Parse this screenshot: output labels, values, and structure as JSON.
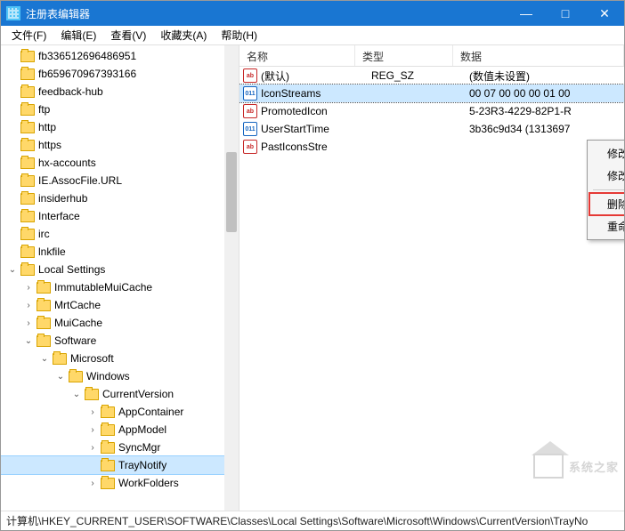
{
  "window": {
    "title": "注册表编辑器"
  },
  "menu": {
    "file": "文件(F)",
    "edit": "编辑(E)",
    "view": "查看(V)",
    "favorites": "收藏夹(A)",
    "help": "帮助(H)"
  },
  "tree": [
    {
      "label": "fb336512696486951",
      "depth": 0,
      "exp": ""
    },
    {
      "label": "fb659670967393166",
      "depth": 0,
      "exp": ""
    },
    {
      "label": "feedback-hub",
      "depth": 0,
      "exp": ""
    },
    {
      "label": "ftp",
      "depth": 0,
      "exp": ""
    },
    {
      "label": "http",
      "depth": 0,
      "exp": ""
    },
    {
      "label": "https",
      "depth": 0,
      "exp": ""
    },
    {
      "label": "hx-accounts",
      "depth": 0,
      "exp": ""
    },
    {
      "label": "IE.AssocFile.URL",
      "depth": 0,
      "exp": ""
    },
    {
      "label": "insiderhub",
      "depth": 0,
      "exp": ""
    },
    {
      "label": "Interface",
      "depth": 0,
      "exp": ""
    },
    {
      "label": "irc",
      "depth": 0,
      "exp": ""
    },
    {
      "label": "lnkfile",
      "depth": 0,
      "exp": ""
    },
    {
      "label": "Local Settings",
      "depth": 0,
      "exp": "open"
    },
    {
      "label": "ImmutableMuiCache",
      "depth": 1,
      "exp": "closed"
    },
    {
      "label": "MrtCache",
      "depth": 1,
      "exp": "closed"
    },
    {
      "label": "MuiCache",
      "depth": 1,
      "exp": "closed"
    },
    {
      "label": "Software",
      "depth": 1,
      "exp": "open"
    },
    {
      "label": "Microsoft",
      "depth": 2,
      "exp": "open"
    },
    {
      "label": "Windows",
      "depth": 3,
      "exp": "open"
    },
    {
      "label": "CurrentVersion",
      "depth": 4,
      "exp": "open"
    },
    {
      "label": "AppContainer",
      "depth": 5,
      "exp": "closed"
    },
    {
      "label": "AppModel",
      "depth": 5,
      "exp": "closed"
    },
    {
      "label": "SyncMgr",
      "depth": 5,
      "exp": "closed"
    },
    {
      "label": "TrayNotify",
      "depth": 5,
      "exp": "",
      "selected": true
    },
    {
      "label": "WorkFolders",
      "depth": 5,
      "exp": "closed"
    }
  ],
  "list": {
    "columns": {
      "name": "名称",
      "type": "类型",
      "data": "数据"
    },
    "rows": [
      {
        "icon": "str",
        "name": "(默认)",
        "type": "REG_SZ",
        "data": "(数值未设置)"
      },
      {
        "icon": "bin",
        "name": "IconStreams",
        "type": "",
        "data": "00 07 00 00 00 01 00",
        "selected": true
      },
      {
        "icon": "str",
        "name": "PromotedIcon",
        "type": "",
        "data": "5-23R3-4229-82P1-R"
      },
      {
        "icon": "bin",
        "name": "UserStartTime",
        "type": "",
        "data": "3b36c9d34 (1313697"
      },
      {
        "icon": "str",
        "name": "PastIconsStre",
        "type": "",
        "data": ""
      }
    ]
  },
  "context": {
    "modify": "修改(M)...",
    "modify_binary": "修改二进制数据(B)...",
    "delete": "删除(D)",
    "rename": "重命名(R)"
  },
  "statusbar": {
    "path": "计算机\\HKEY_CURRENT_USER\\SOFTWARE\\Classes\\Local Settings\\Software\\Microsoft\\Windows\\CurrentVersion\\TrayNo"
  },
  "watermark": {
    "text": "系统之家"
  },
  "icons": {
    "str_glyph": "ab",
    "bin_glyph": "011",
    "min": "—",
    "max": "□",
    "close": "✕"
  }
}
